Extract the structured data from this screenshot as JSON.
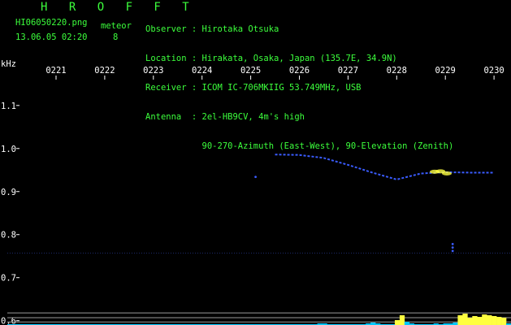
{
  "header": {
    "title": "H R O F F T",
    "filename": "HI06050220.png",
    "datetime": "13.06.05 02:20",
    "meteor_label": "meteor",
    "meteor_count": "8",
    "info_lines": [
      "Observer : Hirotaka Otsuka",
      "Location : Hirakata, Osaka, Japan (135.7E, 34.9N)",
      "Receiver : ICOM IC-706MKIIG 53.749MHz, USB",
      "Antenna  : 2el-HB9CV, 4m's high",
      "           90-270-Azimuth (East-West), 90-Elevation (Zenith)"
    ]
  },
  "colors": {
    "background": "#000000",
    "header_text": "#3cff3c",
    "axis_text": "#ffffff",
    "signal": "#3a5cff",
    "signal_hot": "#ffff40",
    "floor": "#00c8ff"
  },
  "chart_data": {
    "type": "heatmap",
    "ylabel": "kHz",
    "x_ticks": [
      "0221",
      "0222",
      "0223",
      "0224",
      "0225",
      "0226",
      "0227",
      "0228",
      "0229",
      "0230"
    ],
    "y_ticks": [
      "1.1",
      "1.0",
      "0.9",
      "0.8",
      "0.7",
      "0.6"
    ],
    "y_tick_values": [
      1.1,
      1.0,
      0.9,
      0.8,
      0.7,
      0.6
    ],
    "ylim": [
      0.59,
      1.16
    ],
    "xlim": [
      0,
      10
    ],
    "echo_track": [
      {
        "x": 5.5,
        "y": 0.986
      },
      {
        "x": 6.0,
        "y": 0.985
      },
      {
        "x": 6.5,
        "y": 0.978
      },
      {
        "x": 7.0,
        "y": 0.962
      },
      {
        "x": 7.5,
        "y": 0.944
      },
      {
        "x": 8.0,
        "y": 0.928
      },
      {
        "x": 8.5,
        "y": 0.942
      },
      {
        "x": 9.0,
        "y": 0.945
      },
      {
        "x": 9.5,
        "y": 0.944
      },
      {
        "x": 10.0,
        "y": 0.944
      }
    ],
    "hot_spots": [
      {
        "x": 8.78,
        "y": 0.946
      },
      {
        "x": 9.03,
        "y": 0.942
      },
      {
        "x": 8.9,
        "y": 0.947
      }
    ],
    "dots": [
      {
        "x": 5.1,
        "y": 0.934
      },
      {
        "x": 9.15,
        "y": 0.778
      },
      {
        "x": 9.15,
        "y": 0.77
      },
      {
        "x": 9.15,
        "y": 0.762
      }
    ],
    "noise_line_y": 0.757,
    "reference_lines_y": [
      0.618,
      0.607,
      0.597
    ],
    "floor_activity": [
      1,
      1,
      1,
      1,
      1,
      1,
      1,
      1,
      1,
      1,
      1,
      1,
      1,
      1,
      1,
      1,
      1,
      1,
      1,
      1,
      1,
      1,
      1,
      1,
      1,
      1,
      1,
      1,
      1,
      1,
      1,
      1,
      1,
      1,
      1,
      1,
      1,
      1,
      1,
      1,
      1,
      1,
      1,
      1,
      1,
      1,
      1,
      1,
      1,
      1,
      1,
      1,
      1,
      1,
      1,
      1,
      1,
      1,
      1,
      1,
      1,
      1,
      1,
      1,
      2,
      2,
      1,
      1,
      1,
      1,
      1,
      1,
      1,
      1,
      2,
      3,
      2,
      1,
      1,
      1,
      6,
      12,
      4,
      2,
      1,
      1,
      1,
      1,
      2,
      1,
      2,
      2,
      3,
      12,
      14,
      9,
      11,
      10,
      13,
      12,
      11,
      10,
      9,
      2
    ]
  }
}
